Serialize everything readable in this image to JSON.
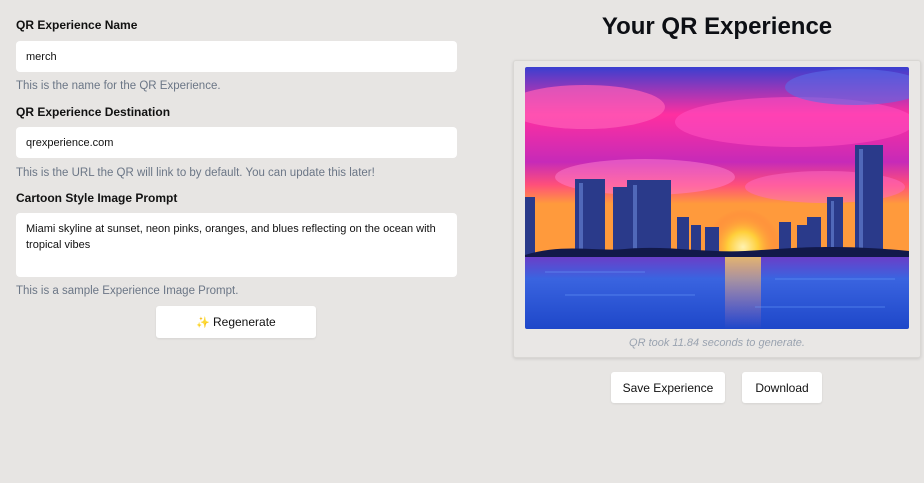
{
  "form": {
    "name_label": "QR Experience Name",
    "name_value": "merch",
    "name_help": "This is the name for the QR Experience.",
    "destination_label": "QR Experience Destination",
    "destination_value": "qrexperience.com",
    "destination_help": "This is the URL the QR will link to by default. You can update this later!",
    "prompt_label": "Cartoon Style Image Prompt",
    "prompt_value": "Miami skyline at sunset, neon pinks, oranges, and blues reflecting on the ocean with tropical vibes",
    "prompt_help": "This is a sample Experience Image Prompt.",
    "regenerate_label": "Regenerate",
    "regenerate_icon": "sparkles-icon"
  },
  "preview": {
    "title": "Your QR Experience",
    "caption": "QR took 11.84 seconds to generate.",
    "save_label": "Save Experience",
    "download_label": "Download"
  },
  "colors": {
    "background": "#e7e5e3",
    "sky_pink": "#ff2fa0",
    "sky_blue": "#2b48c9",
    "sun": "#ffcf3a",
    "water": "#2a5bd8",
    "help_text": "#6b7686"
  }
}
